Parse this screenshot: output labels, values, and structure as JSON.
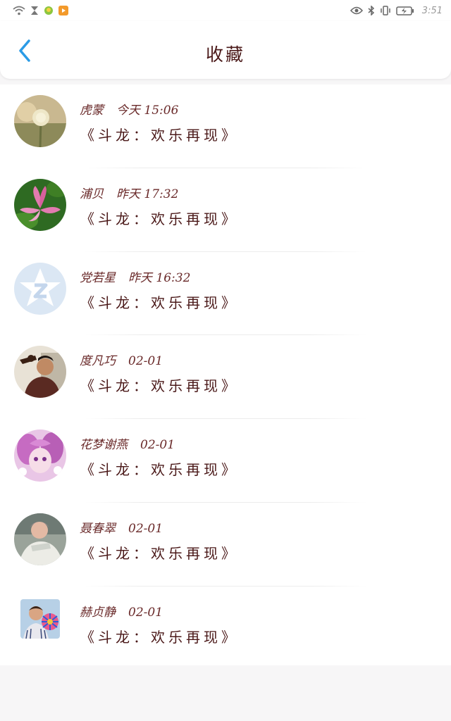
{
  "status_bar": {
    "time": "3:51",
    "left_icons": [
      "wifi-icon",
      "hourglass-icon",
      "notification-app-icon",
      "video-app-icon"
    ],
    "right_icons": [
      "eye-icon",
      "bluetooth-icon",
      "vibrate-icon",
      "battery-charging-icon"
    ]
  },
  "header": {
    "title": "收藏",
    "back_icon": "chevron-left-icon",
    "accent_color": "#2b9be6"
  },
  "favorites": [
    {
      "name": "虎蒙",
      "time": "今天 15:06",
      "title": "《斗龙：欢乐再现》",
      "avatar": "flower-photo"
    },
    {
      "name": "浦贝",
      "time": "昨天 17:32",
      "title": "《斗龙：欢乐再现》",
      "avatar": "lotus-photo"
    },
    {
      "name": "党若星",
      "time": "昨天 16:32",
      "title": "《斗龙：欢乐再现》",
      "avatar": "default-z-star"
    },
    {
      "name": "度凡巧",
      "time": "02-01",
      "title": "《斗龙：欢乐再现》",
      "avatar": "person-photo"
    },
    {
      "name": "花梦谢燕",
      "time": "02-01",
      "title": "《斗龙：欢乐再现》",
      "avatar": "anime-photo"
    },
    {
      "name": "聂春翠",
      "time": "02-01",
      "title": "《斗龙：欢乐再现》",
      "avatar": "person-photo"
    },
    {
      "name": "赫贞静",
      "time": "02-01",
      "title": "《斗龙：欢乐再现》",
      "avatar": "square-person-photo"
    }
  ]
}
